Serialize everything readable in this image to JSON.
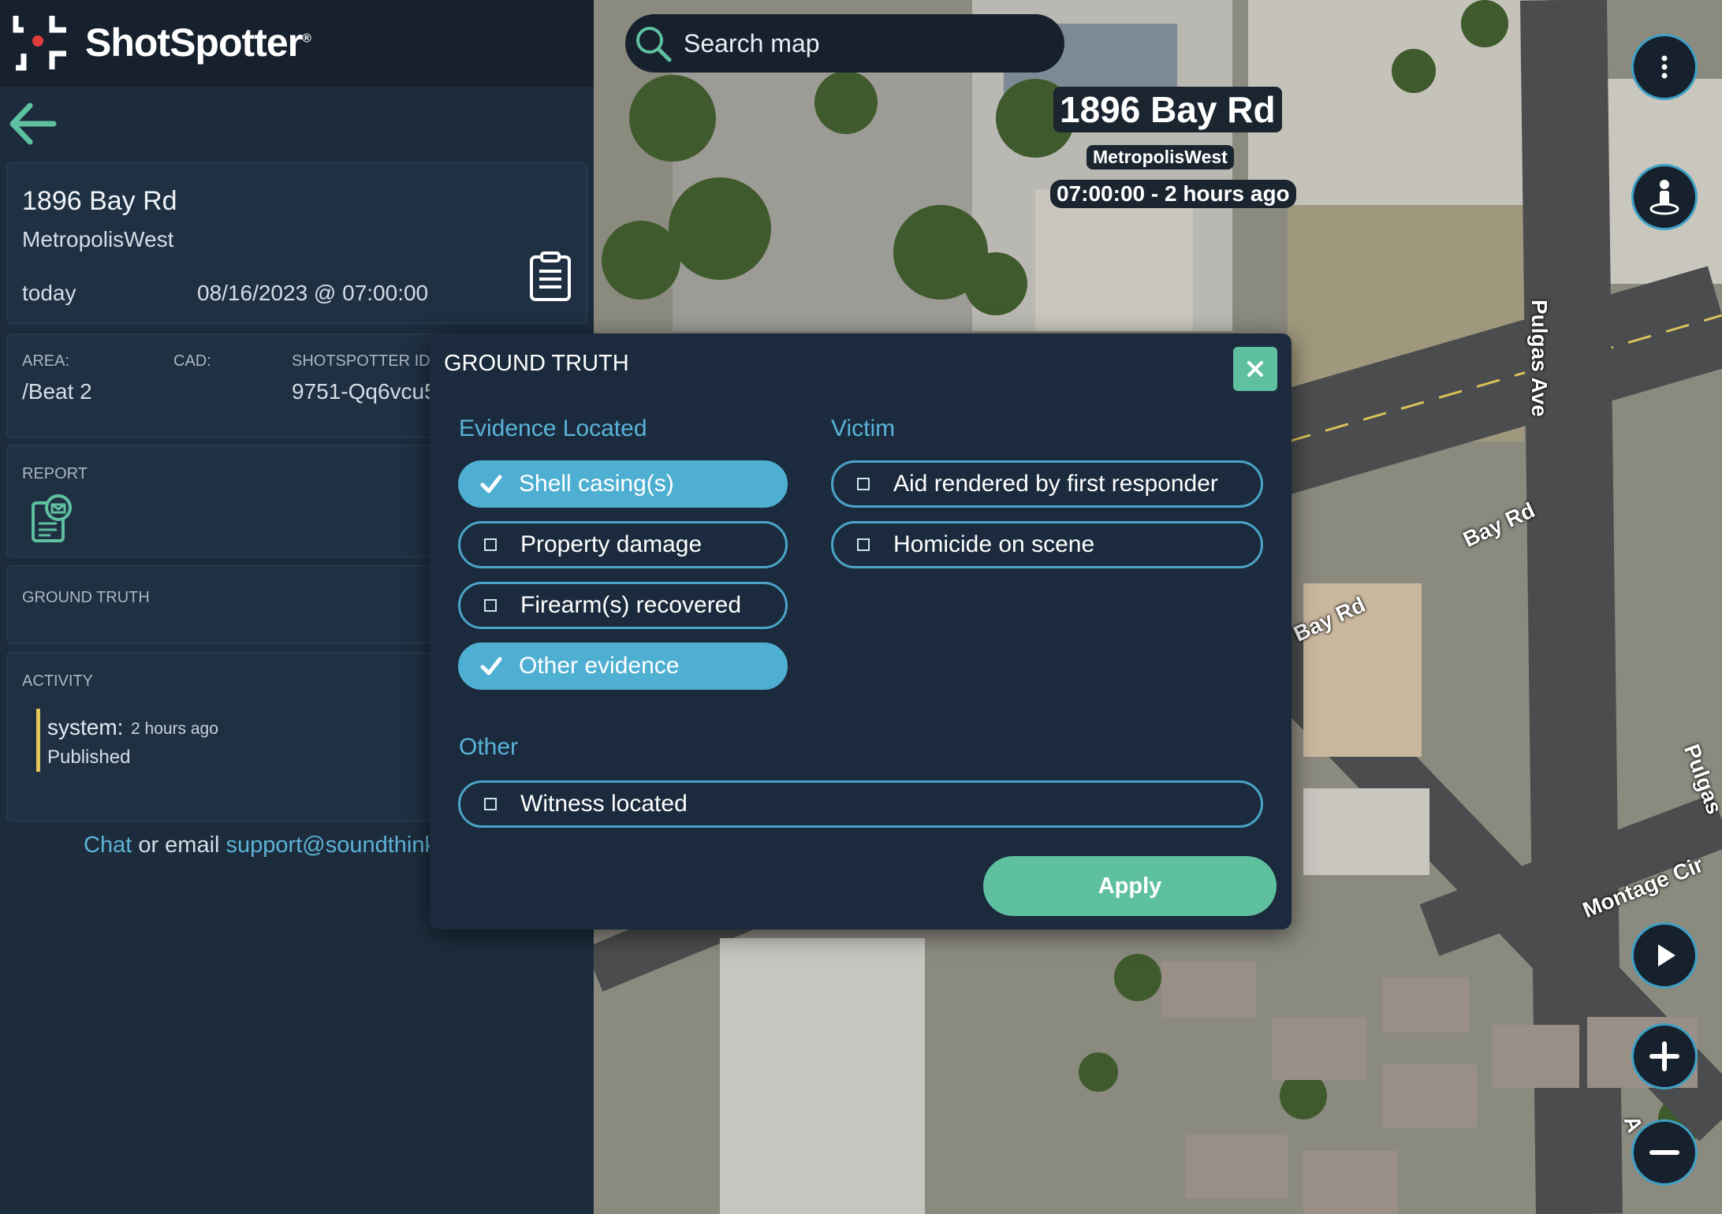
{
  "brand": {
    "name": "ShotSpotter",
    "mark": "®"
  },
  "incident": {
    "address": "1896 Bay Rd",
    "city": "MetropolisWest",
    "day": "today",
    "datetime": "08/16/2023 @ 07:00:00"
  },
  "ids": {
    "area_label": "AREA:",
    "area_value": "/Beat 2",
    "cad_label": "CAD:",
    "cad_value": "",
    "shotspotter_label": "SHOTSPOTTER ID:",
    "shotspotter_value": "9751-Qq6vcu5"
  },
  "sections": {
    "report": "REPORT",
    "ground_truth": "GROUND TRUTH",
    "activity": "ACTIVITY"
  },
  "activity": {
    "user": "system:",
    "time": "2 hours ago",
    "status": "Published"
  },
  "support": {
    "chat": "Chat",
    "middle": " or email ",
    "email": "support@soundthink"
  },
  "search": {
    "placeholder": "Search map"
  },
  "map_labels": {
    "address": "1896 Bay Rd",
    "city": "MetropolisWest",
    "time": "07:00:00 - 2 hours ago",
    "streets": [
      "Pulgas Ave",
      "Bay Rd",
      "Bay Rd",
      "Montage Cir",
      "Pulgas",
      "A"
    ]
  },
  "modal": {
    "title": "GROUND TRUTH",
    "evidence_title": "Evidence Located",
    "evidence": [
      {
        "label": "Shell casing(s)",
        "checked": true
      },
      {
        "label": "Property damage",
        "checked": false
      },
      {
        "label": "Firearm(s) recovered",
        "checked": false
      },
      {
        "label": "Other evidence",
        "checked": true
      }
    ],
    "victim_title": "Victim",
    "victim": [
      {
        "label": "Aid rendered by first responder",
        "checked": false
      },
      {
        "label": "Homicide on scene",
        "checked": false
      }
    ],
    "other_title": "Other",
    "other": [
      {
        "label": "Witness located",
        "checked": false
      }
    ],
    "apply_label": "Apply"
  },
  "colors": {
    "accent": "#4eafd2",
    "apply": "#5fc0a0",
    "panel": "#1d2c3c",
    "activity_bar": "#e4c35a"
  },
  "icons": [
    "back-arrow-icon",
    "clipboard-icon",
    "report-icon",
    "search-icon",
    "more-vert-icon",
    "street-view-icon",
    "play-icon",
    "zoom-in-icon",
    "zoom-out-icon",
    "close-icon",
    "check-icon"
  ]
}
